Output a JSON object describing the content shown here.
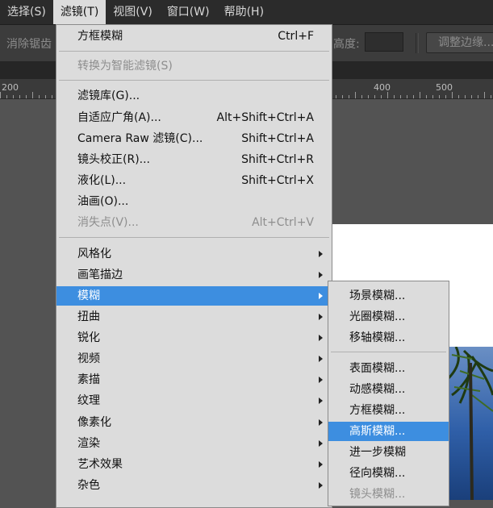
{
  "menubar": {
    "items": [
      {
        "label": "选择(S)"
      },
      {
        "label": "滤镜(T)"
      },
      {
        "label": "视图(V)"
      },
      {
        "label": "窗口(W)"
      },
      {
        "label": "帮助(H)"
      }
    ]
  },
  "options": {
    "antialias_label": "消除锯齿",
    "height_label": "高度:",
    "height_value": "",
    "refine_edge_label": "调整边缘..."
  },
  "ruler": {
    "labels": [
      "200",
      "400",
      "500"
    ]
  },
  "filter_menu": {
    "last_filter": {
      "label": "方框模糊",
      "shortcut": "Ctrl+F"
    },
    "convert_smart": {
      "label": "转换为智能滤镜(S)"
    },
    "gallery": {
      "label": "滤镜库(G)..."
    },
    "adaptive_wide": {
      "label": "自适应广角(A)...",
      "shortcut": "Alt+Shift+Ctrl+A"
    },
    "camera_raw": {
      "label": "Camera Raw 滤镜(C)...",
      "shortcut": "Shift+Ctrl+A"
    },
    "lens_correction": {
      "label": "镜头校正(R)...",
      "shortcut": "Shift+Ctrl+R"
    },
    "liquify": {
      "label": "液化(L)...",
      "shortcut": "Shift+Ctrl+X"
    },
    "oil_paint": {
      "label": "油画(O)..."
    },
    "vanishing_point": {
      "label": "消失点(V)...",
      "shortcut": "Alt+Ctrl+V"
    },
    "categories": [
      {
        "label": "风格化"
      },
      {
        "label": "画笔描边"
      },
      {
        "label": "模糊"
      },
      {
        "label": "扭曲"
      },
      {
        "label": "锐化"
      },
      {
        "label": "视频"
      },
      {
        "label": "素描"
      },
      {
        "label": "纹理"
      },
      {
        "label": "像素化"
      },
      {
        "label": "渲染"
      },
      {
        "label": "艺术效果"
      },
      {
        "label": "杂色"
      }
    ]
  },
  "blur_submenu": {
    "items": [
      {
        "label": "场景模糊..."
      },
      {
        "label": "光圈模糊..."
      },
      {
        "label": "移轴模糊..."
      },
      {
        "label": "表面模糊..."
      },
      {
        "label": "动感模糊..."
      },
      {
        "label": "方框模糊..."
      },
      {
        "label": "高斯模糊..."
      },
      {
        "label": "进一步模糊"
      },
      {
        "label": "径向模糊..."
      },
      {
        "label": "镜头模糊..."
      }
    ]
  },
  "colors": {
    "highlight": "#3d8ee0",
    "menu_bg": "#dcdcdc",
    "app_bg": "#535353"
  }
}
